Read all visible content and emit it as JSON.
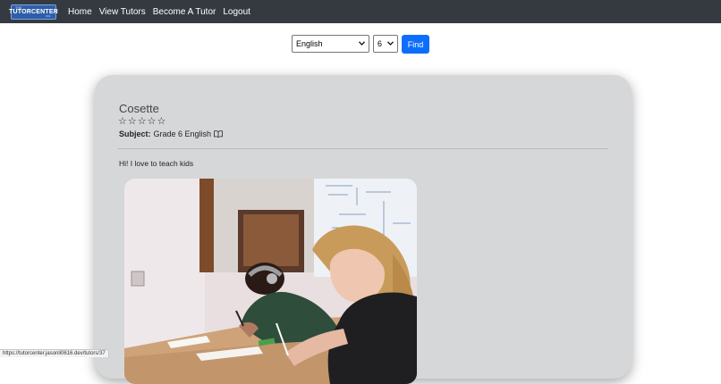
{
  "navbar": {
    "brand": {
      "main": "TUTORCENTER",
      "tag": "THE",
      "sub": "INC"
    },
    "links": [
      "Home",
      "View Tutors",
      "Become A Tutor",
      "Logout"
    ]
  },
  "search": {
    "subject_value": "English",
    "grade_value": "6",
    "find_label": "Find"
  },
  "tutor": {
    "name": "Cosette",
    "rating": 0,
    "rating_max": 5,
    "subject_label": "Subject:",
    "subject_value": "Grade 6 English",
    "bio": "Hi! I love to teach kids"
  },
  "status_bar": {
    "url": "https://tutorcenter.jasonli0616.dev/tutors/37"
  },
  "colors": {
    "navbar": "#343a40",
    "primary": "#0d6efd",
    "card": "#d6d7d9"
  }
}
